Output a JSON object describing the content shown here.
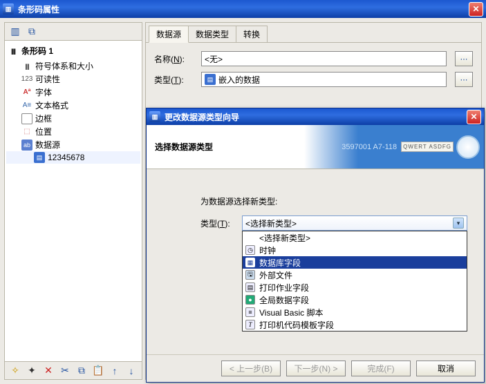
{
  "window": {
    "title": "条形码属性"
  },
  "left_toolbar": {
    "icons": [
      "barcode-icon",
      "copy-icon"
    ]
  },
  "tree": {
    "root": "条形码  1",
    "items": [
      {
        "icon": "barcode",
        "label": "符号体系和大小"
      },
      {
        "icon": "num",
        "label": "可读性"
      },
      {
        "icon": "abc",
        "label": "字体"
      },
      {
        "icon": "txt",
        "label": "文本格式"
      },
      {
        "icon": "border",
        "label": "边框"
      },
      {
        "icon": "pos",
        "label": "位置"
      },
      {
        "icon": "ds",
        "label": "数据源"
      },
      {
        "icon": "ds2",
        "label": "12345678"
      }
    ]
  },
  "tree_bottom_icons": [
    "wand",
    "fx",
    "delete",
    "cut",
    "copy",
    "paste",
    "up",
    "down"
  ],
  "tabs": {
    "items": [
      "数据源",
      "数据类型",
      "转换"
    ],
    "active_index": 0
  },
  "form": {
    "name_label": "名称(N):",
    "name_value": "<无>",
    "type_label": "类型(T):",
    "type_value": "嵌入的数据"
  },
  "dialog": {
    "title": "更改数据源类型向导",
    "banner_title": "选择数据源类型",
    "banner_codes": "3597001   A7-118",
    "banner_keys": "QWERT ASDFG",
    "prompt": "为数据源选择新类型:",
    "type_label": "类型(T):",
    "select_placeholder": "<选择新类型>",
    "options": [
      {
        "label": "<选择新类型>",
        "icon": ""
      },
      {
        "label": "时钟",
        "icon": "clock"
      },
      {
        "label": "数据库字段",
        "icon": "db",
        "selected": true
      },
      {
        "label": "外部文件",
        "icon": "file"
      },
      {
        "label": "打印作业字段",
        "icon": "pj"
      },
      {
        "label": "全局数据字段",
        "icon": "globe"
      },
      {
        "label": "Visual Basic 脚本",
        "icon": "vb"
      },
      {
        "label": "打印机代码模板字段",
        "icon": "T"
      }
    ],
    "buttons": {
      "back": "< 上一步(B)",
      "next": "下一步(N) >",
      "finish": "完成(F)",
      "cancel": "取消"
    }
  }
}
